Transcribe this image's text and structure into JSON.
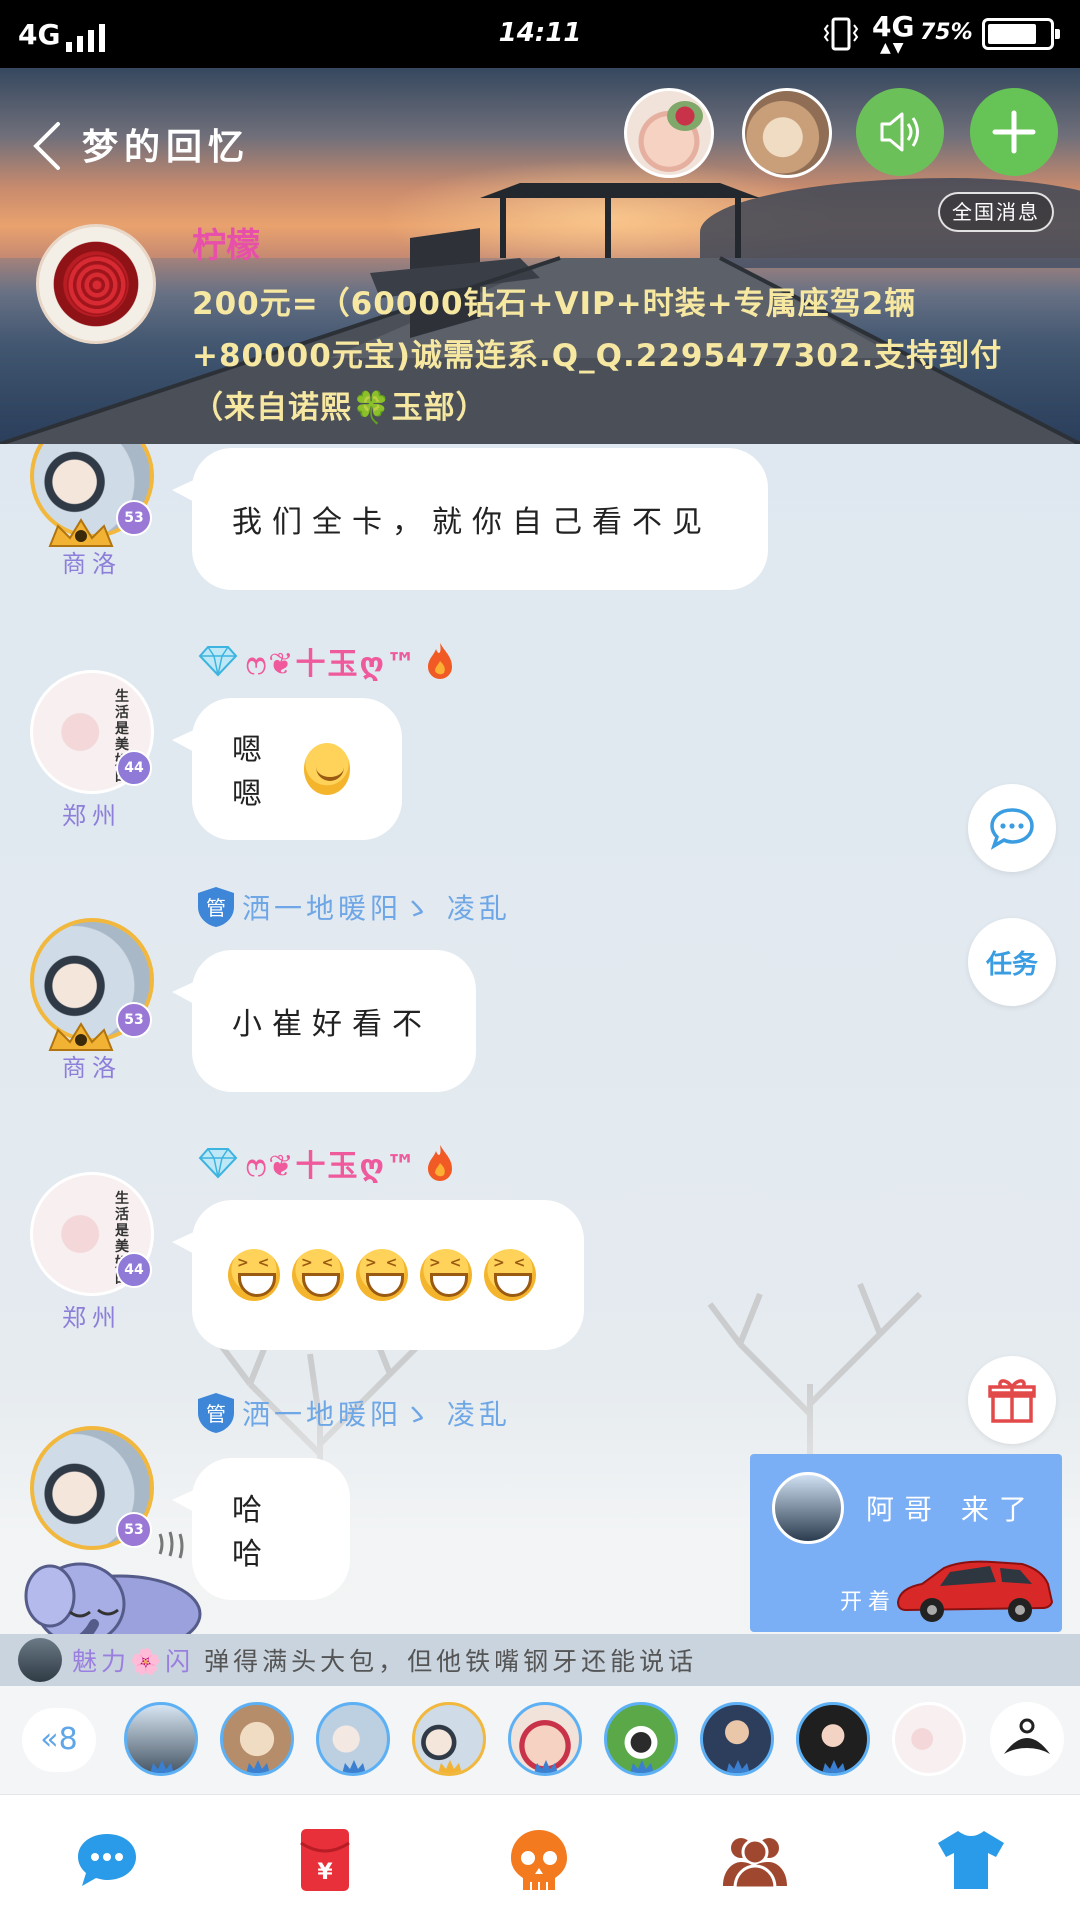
{
  "status_bar": {
    "carrier": "4G",
    "time": "14:11",
    "network": "4G",
    "battery_percent": "75%"
  },
  "header": {
    "title": "梦的回忆",
    "broadcast_label": "全国消息",
    "notice": {
      "sender": "柠檬",
      "text": "200元=（60000钻石+VIP+时装+专属座驾2辆+80000元宝)诚需连系.Q_Q.2295477302.支持到付（来自诺熙🍀玉部）"
    }
  },
  "messages": [
    {
      "city": "商洛",
      "level": "53",
      "text": "我们全卡，就你自己看不见"
    },
    {
      "sender": "ෆ❦十玉ღ™",
      "city": "郑州",
      "level": "44",
      "text": "嗯嗯"
    },
    {
      "sender": "洒一地暖阳ゝ 凌乱",
      "city": "商洛",
      "level": "53",
      "text": "小崔好看不"
    },
    {
      "sender": "ෆ❦十玉ღ™",
      "city": "郑州",
      "level": "44",
      "text": ""
    },
    {
      "sender": "洒一地暖阳ゝ 凌乱",
      "level": "53",
      "text": "哈哈"
    }
  ],
  "side_buttons": {
    "task_label": "任务"
  },
  "entry_notice": {
    "text": "阿哥 来了",
    "drive_label": "开着"
  },
  "ticker": {
    "name": "魅力🌸闪",
    "text": "弹得满头大包，但他铁嘴钢牙还能说话"
  },
  "online": {
    "count_label": "«8"
  },
  "icons": {
    "toolbar": [
      "chat-icon",
      "red-envelope-icon",
      "skull-icon",
      "friends-icon",
      "tshirt-icon"
    ]
  },
  "colors": {
    "accent_green": "#6cc05a",
    "toolbar_blue": "#2a9be8",
    "envelope_red": "#e8303a",
    "skull_orange": "#f47a1f",
    "friends_brown": "#a0482f",
    "vip_pink": "#ef5a9c",
    "admin_blue": "#6fa7e6"
  }
}
